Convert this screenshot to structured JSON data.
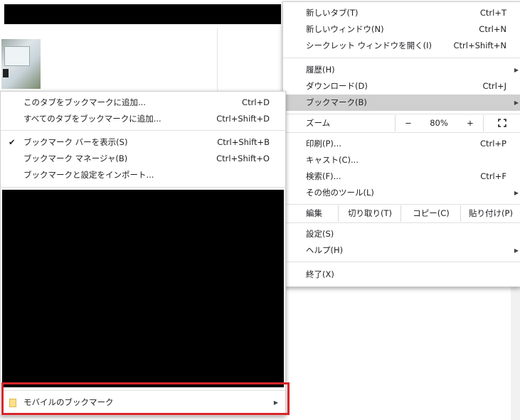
{
  "main_menu": {
    "new_tab": {
      "label": "新しいタブ(T)",
      "shortcut": "Ctrl+T"
    },
    "new_window": {
      "label": "新しいウィンドウ(N)",
      "shortcut": "Ctrl+N"
    },
    "incognito": {
      "label": "シークレット ウィンドウを開く(I)",
      "shortcut": "Ctrl+Shift+N"
    },
    "history": {
      "label": "履歴(H)"
    },
    "downloads": {
      "label": "ダウンロード(D)",
      "shortcut": "Ctrl+J"
    },
    "bookmarks": {
      "label": "ブックマーク(B)"
    },
    "zoom": {
      "label": "ズーム",
      "minus": "−",
      "value": "80%",
      "plus": "+",
      "fullscreen_icon": "fullscreen-icon"
    },
    "print": {
      "label": "印刷(P)...",
      "shortcut": "Ctrl+P"
    },
    "cast": {
      "label": "キャスト(C)..."
    },
    "find": {
      "label": "検索(F)...",
      "shortcut": "Ctrl+F"
    },
    "more_tools": {
      "label": "その他のツール(L)"
    },
    "edit": {
      "label": "編集",
      "cut": "切り取り(T)",
      "copy": "コピー(C)",
      "paste": "貼り付け(P)"
    },
    "settings": {
      "label": "設定(S)"
    },
    "help": {
      "label": "ヘルプ(H)"
    },
    "exit": {
      "label": "終了(X)"
    }
  },
  "bookmark_menu": {
    "add_tab": {
      "label": "このタブをブックマークに追加...",
      "shortcut": "Ctrl+D"
    },
    "add_all": {
      "label": "すべてのタブをブックマークに追加...",
      "shortcut": "Ctrl+Shift+D"
    },
    "show_bar": {
      "label": "ブックマーク バーを表示(S)",
      "shortcut": "Ctrl+Shift+B",
      "checked": true
    },
    "manager": {
      "label": "ブックマーク マネージャ(B)",
      "shortcut": "Ctrl+Shift+O"
    },
    "import": {
      "label": "ブックマークと設定をインポート..."
    },
    "mobile": {
      "label": "モバイルのブックマーク"
    }
  },
  "colors": {
    "highlight_border": "#d8242a",
    "selected_row": "#cfcfcf",
    "folder": "#ffe08a"
  }
}
